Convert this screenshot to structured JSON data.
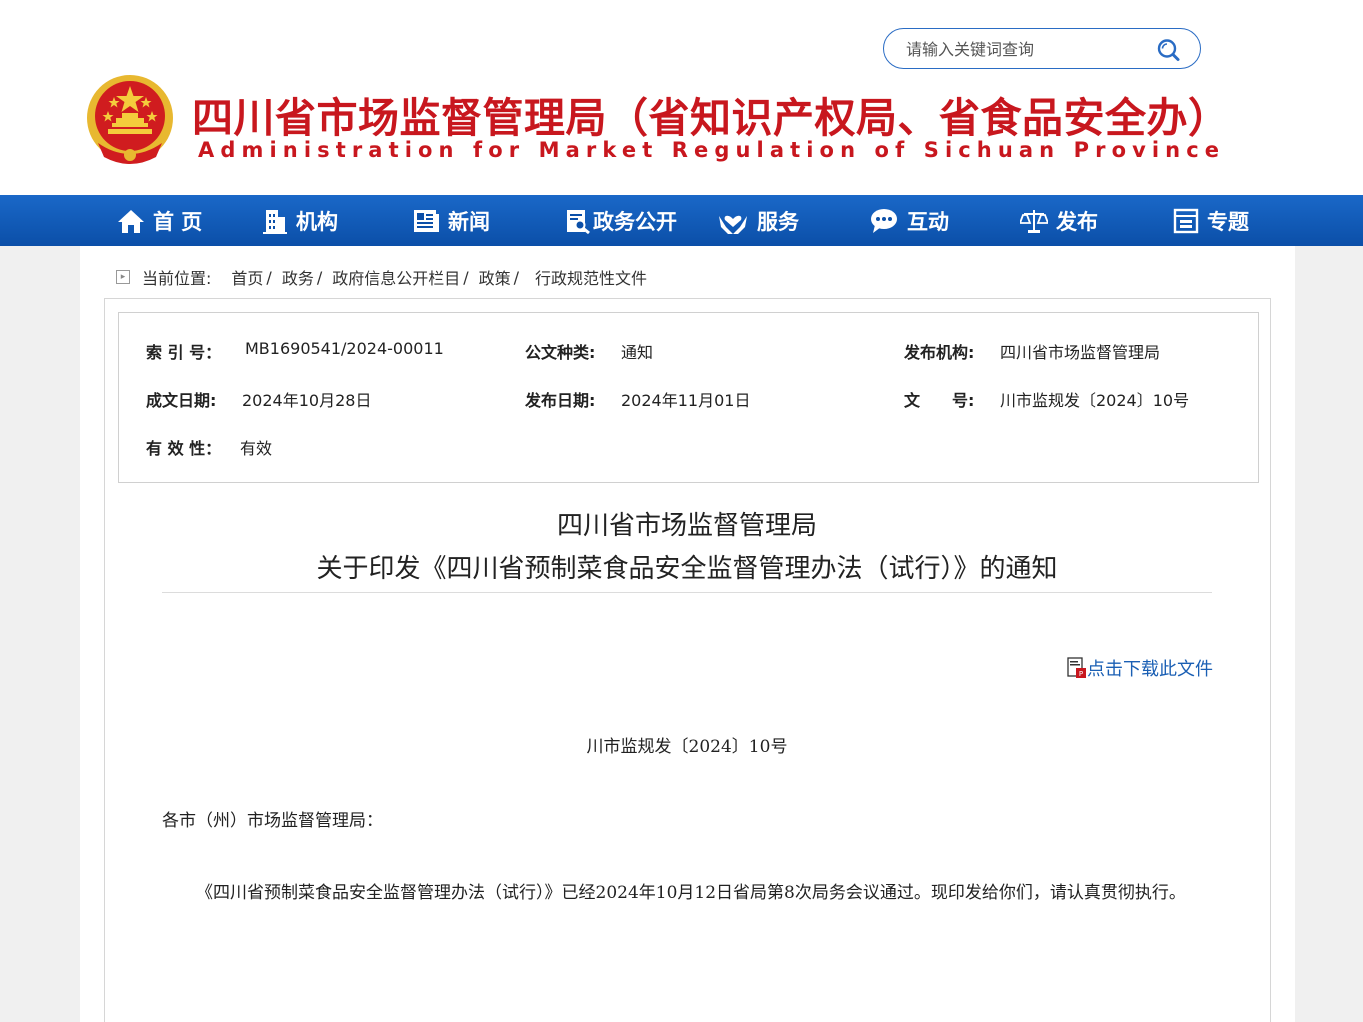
{
  "header": {
    "site_title_cn": "四川省市场监督管理局（省知识产权局、省食品安全办）",
    "site_title_en": "Administration for Market Regulation of Sichuan Province",
    "search": {
      "placeholder": "请输入关键词查询"
    }
  },
  "nav": {
    "items": [
      {
        "label": "首 页",
        "icon": "home-icon"
      },
      {
        "label": "机构",
        "icon": "building-icon"
      },
      {
        "label": "新闻",
        "icon": "newspaper-icon"
      },
      {
        "label": "政务公开",
        "icon": "document-search-icon"
      },
      {
        "label": "服务",
        "icon": "hands-heart-icon"
      },
      {
        "label": "互动",
        "icon": "chat-bubble-icon"
      },
      {
        "label": "发布",
        "icon": "scale-icon"
      },
      {
        "label": "专题",
        "icon": "layout-icon"
      }
    ]
  },
  "breadcrumb": {
    "prefix": "当前位置:",
    "items": [
      "首页",
      "政务",
      "政府信息公开栏目",
      "政策",
      "行政规范性文件"
    ],
    "separator": "/"
  },
  "meta": {
    "index_label": "索 引 号：",
    "index_value": "MB1690541/2024-00011",
    "type_label": "公文种类:",
    "type_value": "通知",
    "publisher_label": "发布机构:",
    "publisher_value": "四川省市场监督管理局",
    "created_label": "成文日期:",
    "created_value": "2024年10月28日",
    "published_label": "发布日期:",
    "published_value": "2024年11月01日",
    "docno_label": "文　　号:",
    "docno_value": "川市监规发〔2024〕10号",
    "validity_label": "有 效 性：",
    "validity_value": "有效"
  },
  "document": {
    "title_line1": "四川省市场监督管理局",
    "title_line2": "关于印发《四川省预制菜食品安全监督管理办法（试行）》的通知",
    "download_label": "点击下载此文件",
    "doc_number": "川市监规发〔2024〕10号",
    "salutation": "各市（州）市场监督管理局：",
    "body": "《四川省预制菜食品安全监督管理办法（试行）》已经2024年10月12日省局第8次局务会议通过。现印发给你们，请认真贯彻执行。"
  },
  "colors": {
    "brand_red": "#c8171e",
    "nav_blue": "#0b4fa8",
    "link_blue": "#1a5fb4"
  }
}
